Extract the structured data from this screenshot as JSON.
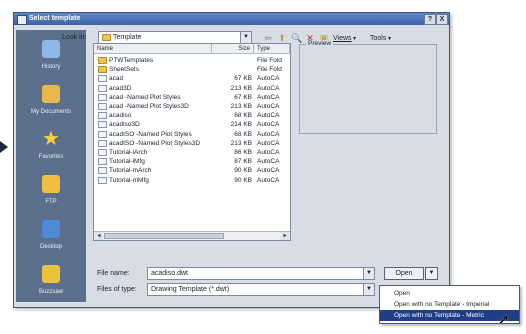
{
  "window": {
    "title": "Select template",
    "help_button": "?",
    "close_button": "X"
  },
  "sidebar": {
    "items": [
      {
        "label": "History",
        "icon": "history-icon",
        "color": "#8fb6e8"
      },
      {
        "label": "My Documents",
        "icon": "my-documents-icon",
        "color": "#e8b84a"
      },
      {
        "label": "Favorites",
        "icon": "favorites-star-icon",
        "color": "#f6d23a"
      },
      {
        "label": "FTP",
        "icon": "ftp-icon",
        "color": "#f0c040"
      },
      {
        "label": "Desktop",
        "icon": "desktop-icon",
        "color": "#4d8bd6"
      },
      {
        "label": "Buzzsaw",
        "icon": "buzzsaw-icon",
        "color": "#e9c23e"
      }
    ]
  },
  "lookin": {
    "label": "Look in:",
    "value": "Template"
  },
  "toolbar": {
    "views_label": "Views",
    "tools_label": "Tools"
  },
  "filelist": {
    "columns": [
      "Name",
      "Size",
      "Type"
    ],
    "rows": [
      {
        "name": "PTWTemplates",
        "size": "",
        "type": "File Fold",
        "kind": "folder"
      },
      {
        "name": "SheetSets",
        "size": "",
        "type": "File Fold",
        "kind": "folder"
      },
      {
        "name": "acad",
        "size": "67 KB",
        "type": "AutoCA",
        "kind": "file"
      },
      {
        "name": "acad3D",
        "size": "213 KB",
        "type": "AutoCA",
        "kind": "file"
      },
      {
        "name": "acad -Named Plot Styles",
        "size": "67 KB",
        "type": "AutoCA",
        "kind": "file"
      },
      {
        "name": "acad -Named Plot Styles3D",
        "size": "213 KB",
        "type": "AutoCA",
        "kind": "file"
      },
      {
        "name": "acadiso",
        "size": "68 KB",
        "type": "AutoCA",
        "kind": "file"
      },
      {
        "name": "acadiso3D",
        "size": "214 KB",
        "type": "AutoCA",
        "kind": "file"
      },
      {
        "name": "acadISO -Named Plot Styles",
        "size": "68 KB",
        "type": "AutoCA",
        "kind": "file"
      },
      {
        "name": "acadISO -Named Plot Styles3D",
        "size": "213 KB",
        "type": "AutoCA",
        "kind": "file"
      },
      {
        "name": "Tutorial-iArch",
        "size": "86 KB",
        "type": "AutoCA",
        "kind": "file"
      },
      {
        "name": "Tutorial-iMfg",
        "size": "87 KB",
        "type": "AutoCA",
        "kind": "file"
      },
      {
        "name": "Tutorial-mArch",
        "size": "90 KB",
        "type": "AutoCA",
        "kind": "file"
      },
      {
        "name": "Tutorial-mMfg",
        "size": "90 KB",
        "type": "AutoCA",
        "kind": "file"
      }
    ]
  },
  "preview": {
    "label": "Preview"
  },
  "filename": {
    "label": "File name:",
    "value": "acadiso.dwt"
  },
  "filetype": {
    "label": "Files of type:",
    "value": "Drawing Template (*.dwt)"
  },
  "open_button": {
    "label": "Open"
  },
  "open_menu": {
    "items": [
      "Open",
      "Open with no Template - Imperial",
      "Open with no Template - Metric"
    ],
    "selected_index": 2
  }
}
